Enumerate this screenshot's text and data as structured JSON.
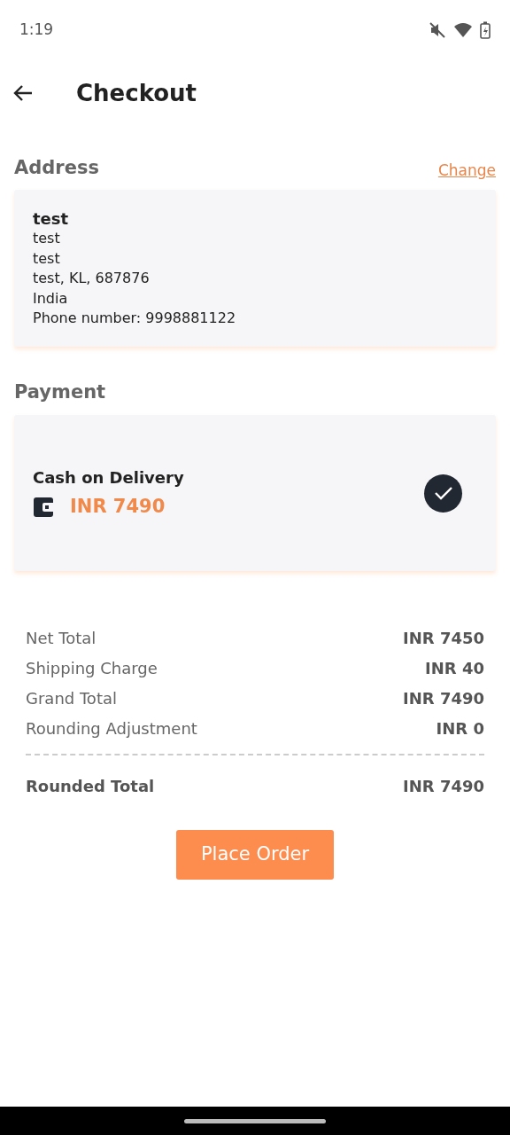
{
  "status_bar": {
    "time": "1:19"
  },
  "header": {
    "title": "Checkout"
  },
  "address": {
    "heading": "Address",
    "action": "Change",
    "name": "test",
    "lines": [
      "test",
      "test",
      "test, KL, 687876",
      "India",
      "Phone number: 9998881122"
    ]
  },
  "payment": {
    "heading": "Payment",
    "method": "Cash on Delivery",
    "amount": "INR 7490",
    "selected": true
  },
  "summary": [
    {
      "label": "Net Total",
      "value": "INR 7450",
      "kind": "line"
    },
    {
      "label": "Shipping Charge",
      "value": "INR 40",
      "kind": "line"
    },
    {
      "label": "Grand Total",
      "value": "INR 7490",
      "kind": "line"
    },
    {
      "label": "Rounding Adjustment",
      "value": "INR 0",
      "kind": "line"
    },
    {
      "label": "Rounded Total",
      "value": "INR 7490",
      "kind": "total"
    }
  ],
  "button": "Place Order"
}
